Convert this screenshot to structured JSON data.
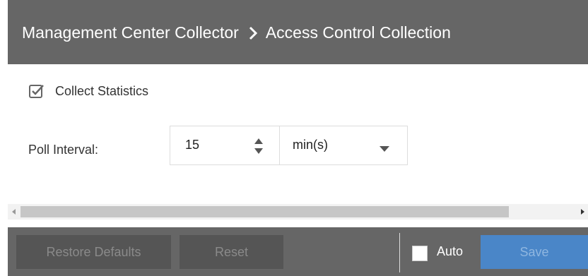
{
  "header": {
    "crumb_parent": "Management Center Collector",
    "crumb_current": "Access Control Collection",
    "separator_icon": "chevron-right-icon"
  },
  "form": {
    "collect_statistics": {
      "label": "Collect Statistics",
      "checked": true
    },
    "poll_interval": {
      "label": "Poll Interval:",
      "value": "15",
      "unit": "min(s)"
    }
  },
  "footer": {
    "restore_defaults_label": "Restore Defaults",
    "reset_label": "Reset",
    "auto_label": "Auto",
    "auto_checked": false,
    "save_label": "Save"
  },
  "colors": {
    "header_bg": "#666666",
    "save_bg": "#4a86c8",
    "disabled_btn_bg": "#555555"
  }
}
